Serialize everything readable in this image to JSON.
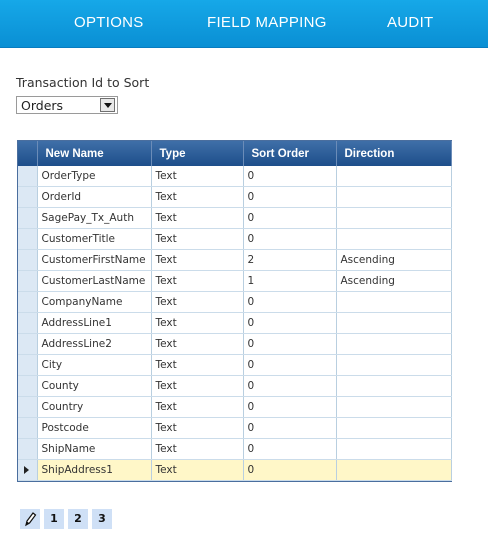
{
  "tabs": [
    {
      "label": "OPTIONS"
    },
    {
      "label": "FIELD MAPPING"
    },
    {
      "label": "AUDIT"
    }
  ],
  "sort": {
    "label": "Transaction Id to Sort",
    "selected": "Orders"
  },
  "grid": {
    "columns": [
      "New Name",
      "Type",
      "Sort Order",
      "Direction"
    ],
    "rows": [
      {
        "name": "OrderType",
        "type": "Text",
        "order": "0",
        "direction": ""
      },
      {
        "name": "OrderId",
        "type": "Text",
        "order": "0",
        "direction": ""
      },
      {
        "name": "SagePay_Tx_Auth",
        "type": "Text",
        "order": "0",
        "direction": ""
      },
      {
        "name": "CustomerTitle",
        "type": "Text",
        "order": "0",
        "direction": ""
      },
      {
        "name": "CustomerFirstName",
        "type": "Text",
        "order": "2",
        "direction": "Ascending"
      },
      {
        "name": "CustomerLastName",
        "type": "Text",
        "order": "1",
        "direction": "Ascending"
      },
      {
        "name": "CompanyName",
        "type": "Text",
        "order": "0",
        "direction": ""
      },
      {
        "name": "AddressLine1",
        "type": "Text",
        "order": "0",
        "direction": ""
      },
      {
        "name": "AddressLine2",
        "type": "Text",
        "order": "0",
        "direction": ""
      },
      {
        "name": "City",
        "type": "Text",
        "order": "0",
        "direction": ""
      },
      {
        "name": "County",
        "type": "Text",
        "order": "0",
        "direction": ""
      },
      {
        "name": "Country",
        "type": "Text",
        "order": "0",
        "direction": ""
      },
      {
        "name": "Postcode",
        "type": "Text",
        "order": "0",
        "direction": ""
      },
      {
        "name": "ShipName",
        "type": "Text",
        "order": "0",
        "direction": ""
      },
      {
        "name": "ShipAddress1",
        "type": "Text",
        "order": "0",
        "direction": "",
        "current": true
      }
    ]
  },
  "pager": {
    "icon": "pencil-icon",
    "pages": [
      "1",
      "2",
      "3"
    ]
  },
  "colors": {
    "header_bar": "#0a8fd4",
    "grid_header": "#1d4e8a",
    "current_row": "#fff7c8",
    "pager_bg": "#cfe0f6"
  }
}
